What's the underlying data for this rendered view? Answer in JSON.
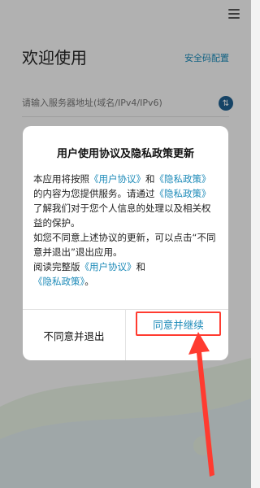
{
  "header": {
    "title": "欢迎使用",
    "config_link": "安全码配置"
  },
  "server": {
    "placeholder": "请输入服务器地址(域名/IPv4/IPv6)",
    "switch_icon": "swap-icon"
  },
  "dialog": {
    "title": "用户使用协议及隐私政策更新",
    "body": {
      "p1_a": "本应用将按照",
      "user_agreement": "《用户协议》",
      "p1_and": "和",
      "privacy_policy": "《隐私政策》",
      "p1_b": "的内容为您提供服务。请通过",
      "p1_c": "了解我们对于您个人信息的处理以及相关权益的保护。",
      "p2": "如您不同意上述协议的更新，可以点击“不同意并退出”退出应用。",
      "p3_a": "阅读完整版",
      "p3_and": "和",
      "p3_end": "。"
    },
    "cancel_label": "不同意并退出",
    "agree_label": "同意并继续"
  },
  "colors": {
    "accent": "#1c8ab8",
    "highlight": "#ff3b30"
  }
}
